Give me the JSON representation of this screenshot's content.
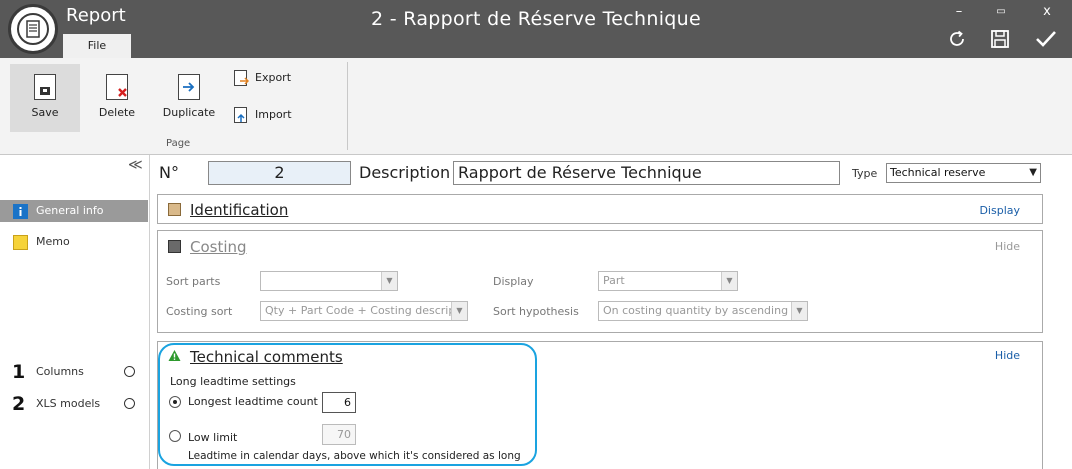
{
  "app": {
    "name": "Report",
    "file_tab": "File",
    "window_title": "2 - Rapport de Réserve Technique"
  },
  "window_controls": {
    "minimize": "–",
    "maximize": "▭",
    "close": "x"
  },
  "toolbar_icons": [
    "refresh-icon",
    "save-disk-icon",
    "checkmark-icon"
  ],
  "ribbon": {
    "save": "Save",
    "delete": "Delete",
    "duplicate": "Duplicate",
    "export": "Export",
    "import": "Import",
    "group": "Page"
  },
  "nav": {
    "collapse": "≪",
    "general_info": "General info",
    "memo": "Memo",
    "columns_num": "1",
    "columns": "Columns",
    "xls_num": "2",
    "xls_models": "XLS models"
  },
  "header": {
    "number_label": "N°",
    "number": "2",
    "description_label": "Description",
    "description": "Rapport de Réserve Technique",
    "type_label": "Type",
    "type": "Technical reserve"
  },
  "identification": {
    "title": "Identification",
    "action": "Display"
  },
  "costing": {
    "title": "Costing",
    "action": "Hide",
    "sort_parts_label": "Sort parts",
    "sort_parts": "",
    "display_label": "Display",
    "display": "Part",
    "costing_sort_label": "Costing sort",
    "costing_sort": "Qty + Part Code + Costing description",
    "sort_hypothesis_label": "Sort hypothesis",
    "sort_hypothesis": "On costing quantity by ascending order"
  },
  "technical": {
    "title": "Technical comments",
    "action": "Hide",
    "settings_label": "Long leadtime settings",
    "longest_label": "Longest leadtime count",
    "longest_value": "6",
    "low_limit_label": "Low limit",
    "low_limit_value": "70",
    "note": "Leadtime in calendar days, above which it's considered as long"
  },
  "colors": {
    "accent": "#1aa3e0",
    "titlebar": "#585858",
    "link": "#1a5ea8"
  }
}
